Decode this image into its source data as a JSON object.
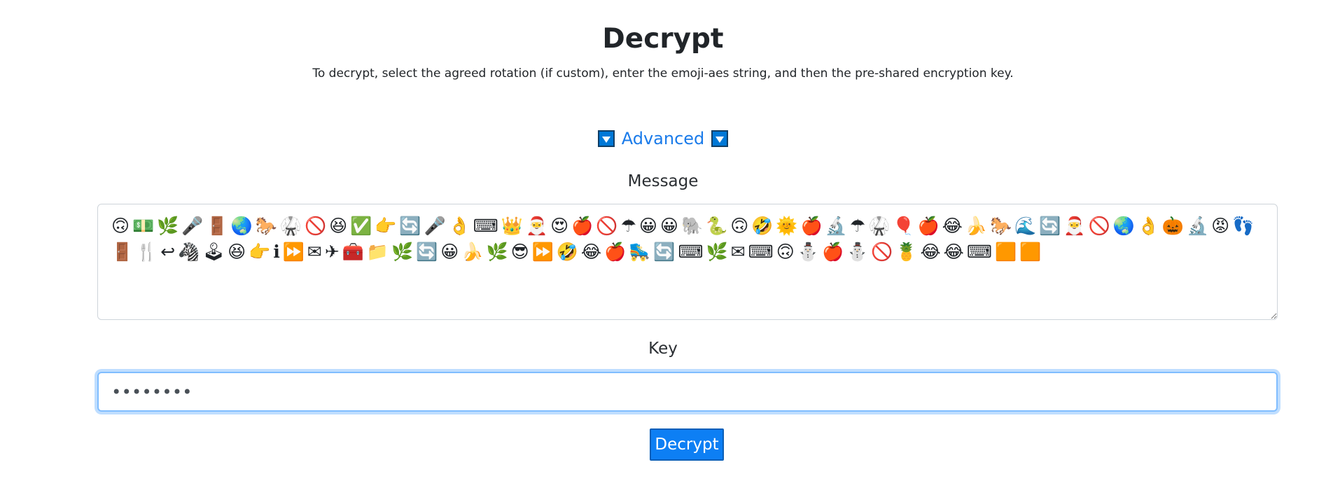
{
  "header": {
    "title": "Decrypt",
    "subtitle": "To decrypt, select the agreed rotation (if custom), enter the emoji-aes string, and then the pre-shared encryption key."
  },
  "advanced": {
    "label": "Advanced",
    "left_icon": "triangle-down-icon",
    "right_icon": "triangle-down-icon",
    "icon_color": "#0078d7"
  },
  "message": {
    "label": "Message",
    "value": "🙃💵🌿🎤🚪🌏🐎🥋🚫😆✅👉🔄🎤👌⌨👑🎅😍🍎🚫☂😀😀🐘🐍🙃🤣🌞🍎🔬☂🥋🎈🍎😂🍌🐎🌊🔄🎅🚫🌏👌🎃🔬😡👣🚪🍴↩🦓🕹😆👉ℹ⏩✉✈🧰📁🌿🔄😀🍌🌿😎⏩🤣😂🍎🛼🔄⌨🌿✉⌨🙃⛄🍎⛄🚫🍍😂😂⌨🟧🟧"
  },
  "key": {
    "label": "Key",
    "value": "abcdefgh"
  },
  "decrypt_button": {
    "label": "Decrypt",
    "color": "#0d7ff4"
  }
}
